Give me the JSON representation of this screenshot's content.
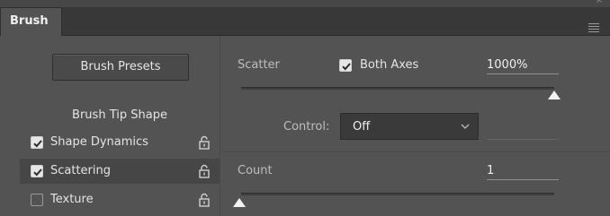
{
  "panel": {
    "tab_label": "Brush"
  },
  "left": {
    "presets_button": "Brush Presets",
    "list_header": "Brush Tip Shape",
    "items": [
      {
        "label": "Shape Dynamics",
        "checked": true,
        "selected": false
      },
      {
        "label": "Scattering",
        "checked": true,
        "selected": true
      },
      {
        "label": "Texture",
        "checked": false,
        "selected": false
      }
    ]
  },
  "scatter": {
    "label": "Scatter",
    "both_axes_label": "Both Axes",
    "both_axes_checked": true,
    "value": "1000%",
    "slider_fraction": 1.0
  },
  "control": {
    "label": "Control:",
    "selected": "Off"
  },
  "count": {
    "label": "Count",
    "value": "1",
    "slider_fraction": 0.0
  },
  "icons": {
    "menu": "panel-menu-icon",
    "lock": "lock-icon",
    "check": "checkmark-icon",
    "chevron": "chevron-down-icon",
    "close": "close-icon"
  }
}
